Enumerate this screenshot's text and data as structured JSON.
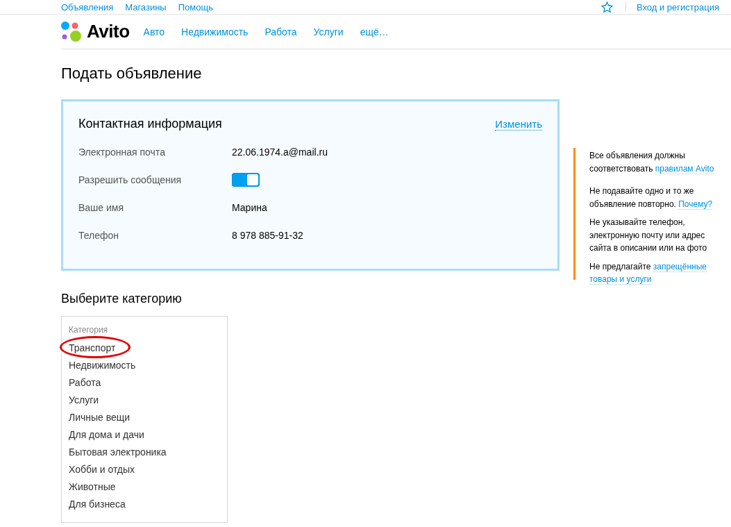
{
  "top_links": [
    "Объявления",
    "Магазины",
    "Помощь"
  ],
  "login": "Вход и регистрация",
  "logo": "Avito",
  "nav": [
    "Авто",
    "Недвижимость",
    "Работа",
    "Услуги",
    "ещё…"
  ],
  "page_title": "Подать объявление",
  "contact": {
    "title": "Контактная информация",
    "edit": "Изменить",
    "fields": [
      {
        "kind": "text",
        "label": "Электронная почта",
        "value": "22.06.1974.a@mail.ru"
      },
      {
        "kind": "toggle",
        "label": "Разрешить сообщения",
        "on": true
      },
      {
        "kind": "text",
        "label": "Ваше имя",
        "value": "Марина"
      },
      {
        "kind": "text",
        "label": "Телефон",
        "value": "8 978 885-91-32"
      }
    ]
  },
  "notes": [
    {
      "text": "Все объявления должны соответствовать",
      "links": [
        "правилам Avito"
      ]
    },
    {
      "text": "Не подавайте одно и то же объявление повторно.",
      "links": [
        "Почему?"
      ]
    },
    {
      "text": "Не указывайте телефон, электронную почту или адрес сайта в описании или на фото"
    },
    {
      "text": "Не предлагайте",
      "links": [
        "запрещённые",
        "товары и услуги"
      ]
    }
  ],
  "category_section": {
    "title": "Выберите категорию",
    "label": "Категория",
    "items": [
      {
        "name": "Транспорт",
        "circled": true
      },
      {
        "name": "Недвижимость",
        "circled": false
      },
      {
        "name": "Работа",
        "circled": false
      },
      {
        "name": "Услуги",
        "circled": false
      },
      {
        "name": "Личные вещи",
        "circled": false
      },
      {
        "name": "Для дома и дачи",
        "circled": false
      },
      {
        "name": "Бытовая электроника",
        "circled": false
      },
      {
        "name": "Хобби и отдых",
        "circled": false
      },
      {
        "name": "Животные",
        "circled": false
      },
      {
        "name": "Для бизнеса",
        "circled": false
      }
    ]
  }
}
